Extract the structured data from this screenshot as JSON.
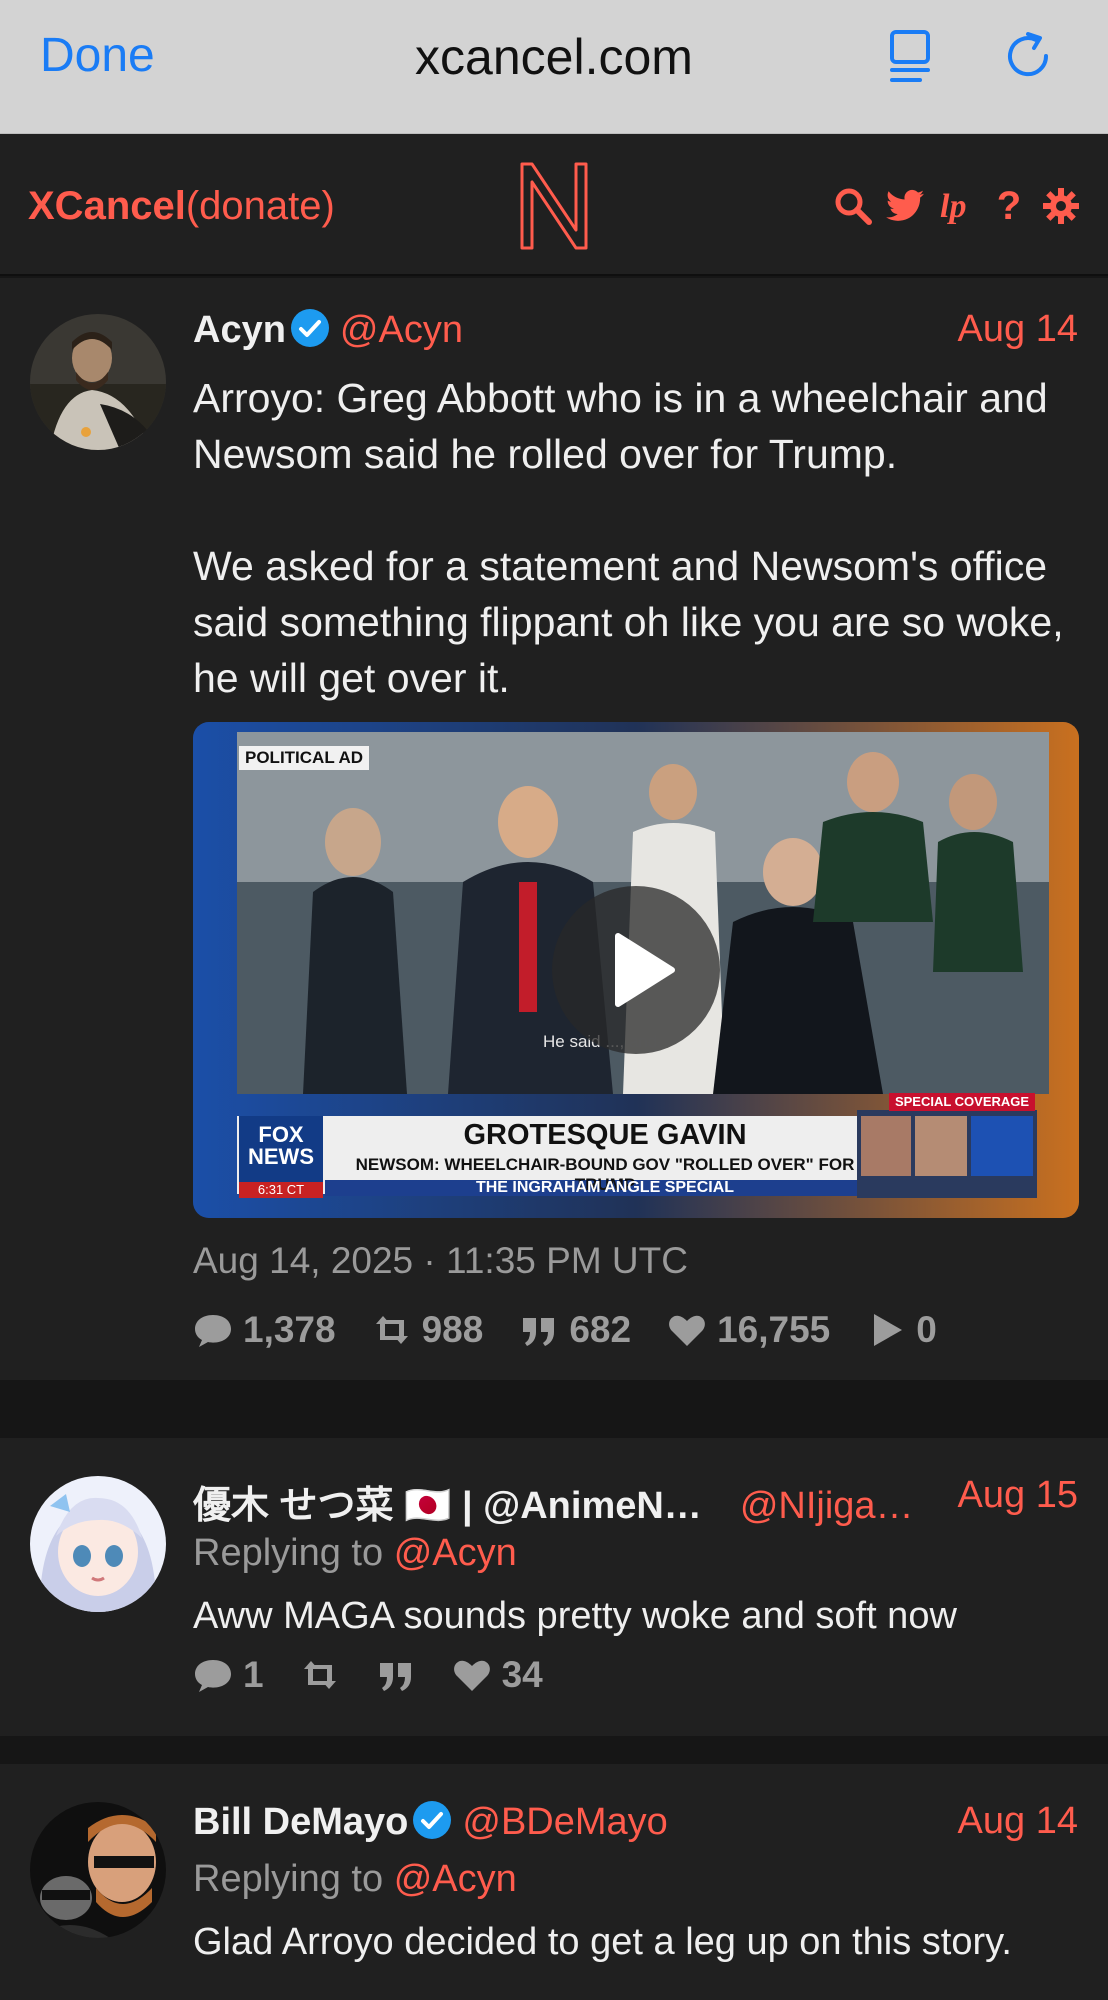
{
  "browser": {
    "done_label": "Done",
    "url": "xcancel.com"
  },
  "site": {
    "brand_name": "XCancel",
    "donate_label": "(donate)",
    "accent_color": "#ff5c4d",
    "icons": [
      "search-icon",
      "twitter-bird-icon",
      "liberapay-icon",
      "help-icon",
      "settings-gear-icon"
    ],
    "help_glyph": "?"
  },
  "main_tweet": {
    "fullname": "Acyn",
    "verified": true,
    "username": "@Acyn",
    "date": "Aug 14",
    "text_para1": "Arroyo: Greg Abbott who is in a wheelchair and Newsom said he rolled over for Trump.",
    "text_para2": "We asked for a statement and Newsom's office said something flippant oh like you are so woke, he will get over it.",
    "media": {
      "badge": "POLITICAL AD",
      "caption": "He said ..., and-",
      "chyron_title": "GROTESQUE GAVIN",
      "chyron_subtitle": "NEWSOM: WHEELCHAIR-BOUND GOV \"ROLLED OVER\" FOR TRUMP",
      "show_name": "THE INGRAHAM ANGLE SPECIAL",
      "network": "FOX NEWS",
      "time_bug": "6:31 CT",
      "special_coverage": "SPECIAL COVERAGE"
    },
    "full_timestamp": "Aug 14, 2025 · 11:35 PM UTC",
    "stats": {
      "replies": "1,378",
      "retweets": "988",
      "quotes": "682",
      "likes": "16,755",
      "views": "0"
    }
  },
  "replies": [
    {
      "fullname": "優木 せつ菜 🇯🇵 | @AnimeN…",
      "username": "@NIjiga…",
      "date": "Aug 15",
      "replying_prefix": "Replying to",
      "replying_to": "@Acyn",
      "text": "Aww MAGA sounds pretty woke and soft now",
      "stats": {
        "replies": "1",
        "retweets": "",
        "quotes": "",
        "likes": "34"
      }
    },
    {
      "fullname": "Bill DeMayo",
      "verified": true,
      "username": "@BDeMayo",
      "date": "Aug 14",
      "replying_prefix": "Replying to",
      "replying_to": "@Acyn",
      "text": "Glad Arroyo decided to get a leg up on this story."
    }
  ]
}
